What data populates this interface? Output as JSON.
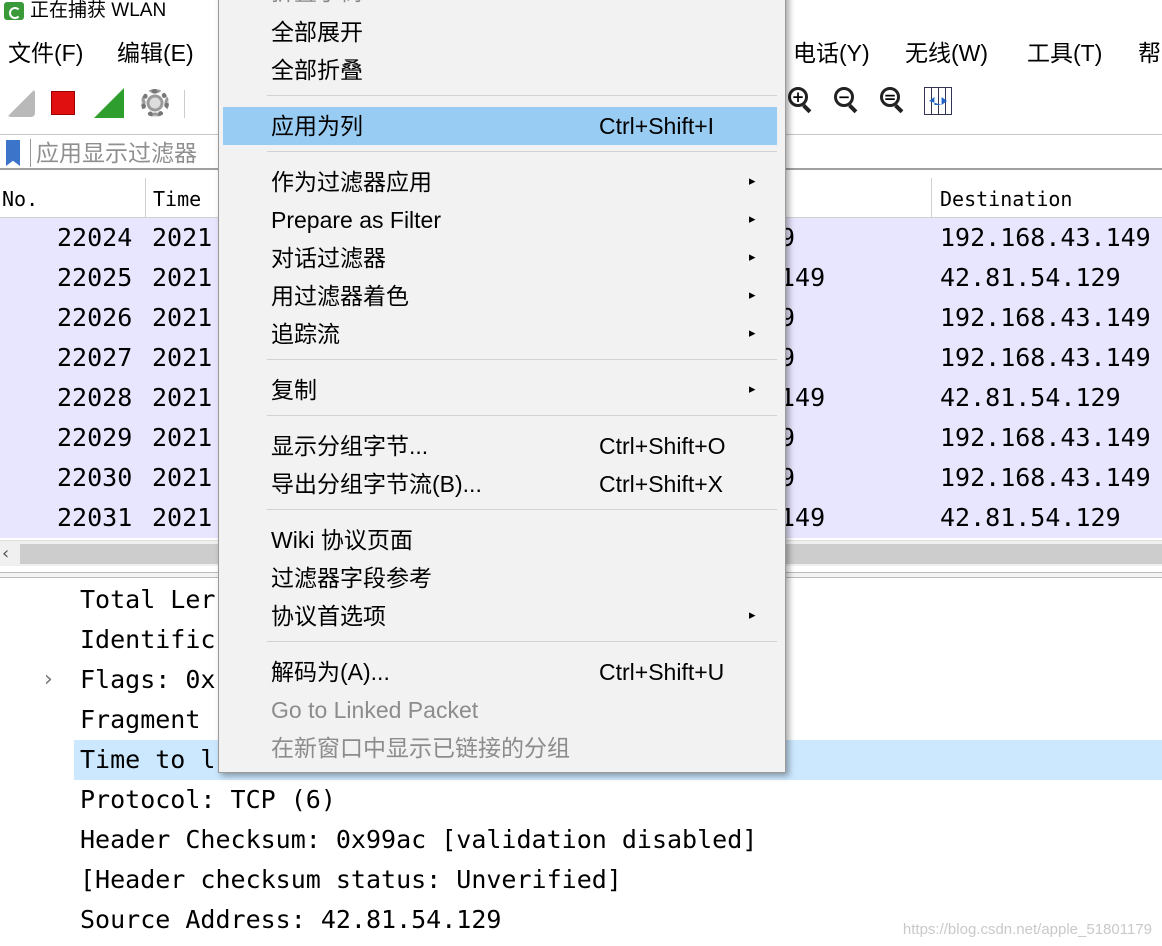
{
  "window": {
    "title": "正在捕获 WLAN"
  },
  "menubar": {
    "items": [
      "文件(F)",
      "编辑(E)",
      "电话(Y)",
      "无线(W)",
      "工具(T)",
      "帮"
    ]
  },
  "toolbar": {
    "icons": [
      "shark-start-icon",
      "stop-capture-icon",
      "restart-capture-icon",
      "capture-options-icon",
      "zoom-in-icon",
      "zoom-out-icon",
      "zoom-normal-icon",
      "resize-columns-icon"
    ]
  },
  "filter": {
    "placeholder": "应用显示过滤器"
  },
  "packet_list": {
    "columns": [
      "No.",
      "Time",
      "Destination"
    ],
    "rows": [
      {
        "no": "22024",
        "time": "2021",
        "src_tail": "9",
        "destination": "192.168.43.149"
      },
      {
        "no": "22025",
        "time": "2021",
        "src_tail": "149",
        "destination": "42.81.54.129"
      },
      {
        "no": "22026",
        "time": "2021",
        "src_tail": "9",
        "destination": "192.168.43.149"
      },
      {
        "no": "22027",
        "time": "2021",
        "src_tail": "9",
        "destination": "192.168.43.149"
      },
      {
        "no": "22028",
        "time": "2021",
        "src_tail": "149",
        "destination": "42.81.54.129"
      },
      {
        "no": "22029",
        "time": "2021",
        "src_tail": "9",
        "destination": "192.168.43.149"
      },
      {
        "no": "22030",
        "time": "2021",
        "src_tail": "9",
        "destination": "192.168.43.149"
      },
      {
        "no": "22031",
        "time": "2021",
        "src_tail": "149",
        "destination": "42.81.54.129"
      }
    ],
    "scroll_left_arrow": "‹"
  },
  "details": {
    "rows": [
      {
        "text": "Total Ler",
        "expander": ""
      },
      {
        "text": "Identific",
        "expander": ""
      },
      {
        "text": "Flags: 0x",
        "expander": "›"
      },
      {
        "text": "Fragment",
        "expander": ""
      },
      {
        "text": "Time to l",
        "expander": ""
      },
      {
        "text": "Protocol: TCP (6)",
        "expander": ""
      },
      {
        "text": "Header Checksum: 0x99ac [validation disabled]",
        "expander": ""
      },
      {
        "text": "[Header checksum status: Unverified]",
        "expander": ""
      },
      {
        "text": "Source Address: 42.81.54.129",
        "expander": ""
      }
    ]
  },
  "context_menu": {
    "partial_top": "折叠子树",
    "items": [
      {
        "label": "全部展开",
        "shortcut": "",
        "submenu": ""
      },
      {
        "label": "全部折叠",
        "shortcut": "",
        "submenu": ""
      },
      {
        "label": "应用为列",
        "shortcut": "Ctrl+Shift+I",
        "submenu": ""
      },
      {
        "label": "作为过滤器应用",
        "shortcut": "",
        "submenu": "▸"
      },
      {
        "label": "Prepare as Filter",
        "shortcut": "",
        "submenu": "▸"
      },
      {
        "label": "对话过滤器",
        "shortcut": "",
        "submenu": "▸"
      },
      {
        "label": "用过滤器着色",
        "shortcut": "",
        "submenu": "▸"
      },
      {
        "label": "追踪流",
        "shortcut": "",
        "submenu": "▸"
      },
      {
        "label": "复制",
        "shortcut": "",
        "submenu": "▸"
      },
      {
        "label": "显示分组字节...",
        "shortcut": "Ctrl+Shift+O",
        "submenu": ""
      },
      {
        "label": "导出分组字节流(B)...",
        "shortcut": "Ctrl+Shift+X",
        "submenu": ""
      },
      {
        "label": "Wiki 协议页面",
        "shortcut": "",
        "submenu": ""
      },
      {
        "label": "过滤器字段参考",
        "shortcut": "",
        "submenu": ""
      },
      {
        "label": "协议首选项",
        "shortcut": "",
        "submenu": "▸"
      },
      {
        "label": "解码为(A)...",
        "shortcut": "Ctrl+Shift+U",
        "submenu": ""
      },
      {
        "label": "Go to Linked Packet",
        "shortcut": "",
        "submenu": ""
      },
      {
        "label": "在新窗口中显示已链接的分组",
        "shortcut": "",
        "submenu": ""
      }
    ]
  },
  "watermark": "https://blog.csdn.net/apple_51801179",
  "colors": {
    "row_bg": "#e7e6fe",
    "menu_highlight": "#99ccf3",
    "detail_selected": "#cce8ff"
  }
}
